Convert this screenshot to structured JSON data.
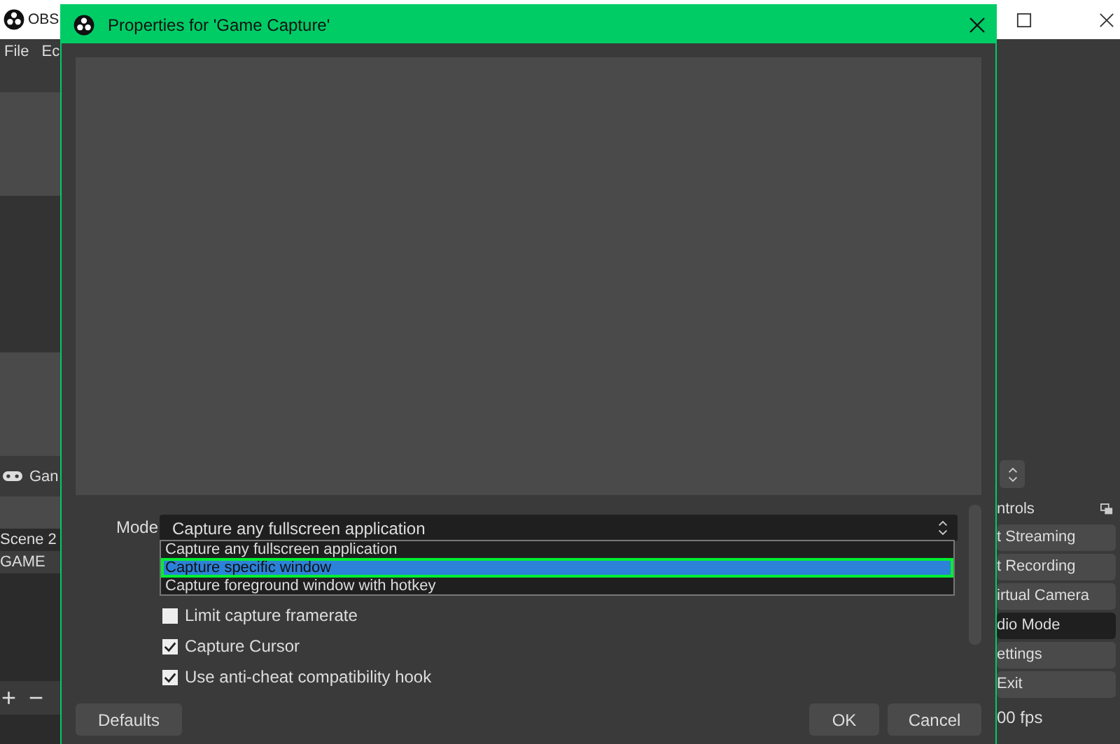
{
  "main_window": {
    "title": "OBS",
    "menu": [
      "File",
      "Ec"
    ],
    "sources_toolbar": {
      "label": "Gan"
    },
    "scenes": [
      {
        "name": "Scene 2",
        "selected": false
      },
      {
        "name": "GAME",
        "selected": true
      }
    ],
    "scene_buttons": [
      "+",
      "−"
    ],
    "controls": {
      "title": "ntrols",
      "buttons": [
        {
          "label": "t Streaming",
          "active": false
        },
        {
          "label": "t Recording",
          "active": false
        },
        {
          "label": "irtual Camera",
          "active": false
        },
        {
          "label": "dio Mode",
          "active": true
        },
        {
          "label": "ettings",
          "active": false
        },
        {
          "label": "Exit",
          "active": false
        }
      ]
    },
    "status": "00 fps"
  },
  "dialog": {
    "title": "Properties for 'Game Capture'",
    "mode": {
      "label": "Mode",
      "value": "Capture any fullscreen application",
      "options": [
        {
          "label": "Capture any fullscreen application",
          "highlighted": false
        },
        {
          "label": "Capture specific window",
          "highlighted": true
        },
        {
          "label": "Capture foreground window with hotkey",
          "highlighted": false
        }
      ]
    },
    "checkboxes": [
      {
        "label": "Limit capture framerate",
        "checked": false
      },
      {
        "label": "Capture Cursor",
        "checked": true
      },
      {
        "label": "Use anti-cheat compatibility hook",
        "checked": true
      }
    ],
    "buttons_left": [
      "Defaults"
    ],
    "buttons_right": [
      "OK",
      "Cancel"
    ]
  }
}
